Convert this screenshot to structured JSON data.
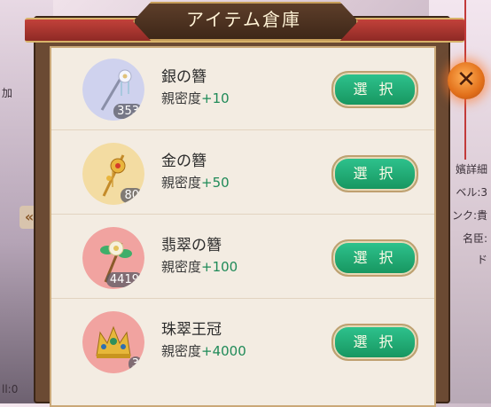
{
  "background": {
    "left_texts": [
      "加",
      "ll:0"
    ],
    "right_texts": [
      "嬪詳細",
      "ベル:3",
      "ンク:貴",
      "名臣:",
      "ド"
    ],
    "collapse_arrow": "«"
  },
  "window": {
    "title": "アイテム倉庫",
    "close_symbol": "✕"
  },
  "items": [
    {
      "name": "銀の簪",
      "affinity_label": "親密度",
      "affinity_value": "+10",
      "count": "353",
      "select_label": "選 択",
      "bg": "#cfd2ee"
    },
    {
      "name": "金の簪",
      "affinity_label": "親密度",
      "affinity_value": "+50",
      "count": "80",
      "select_label": "選 択",
      "bg": "#f3dca2"
    },
    {
      "name": "翡翠の簪",
      "affinity_label": "親密度",
      "affinity_value": "+100",
      "count": "4419",
      "select_label": "選 択",
      "bg": "#f1a3a0"
    },
    {
      "name": "珠翠王冠",
      "affinity_label": "親密度",
      "affinity_value": "+4000",
      "count": "3",
      "select_label": "選 択",
      "bg": "#f1a3a0"
    }
  ]
}
